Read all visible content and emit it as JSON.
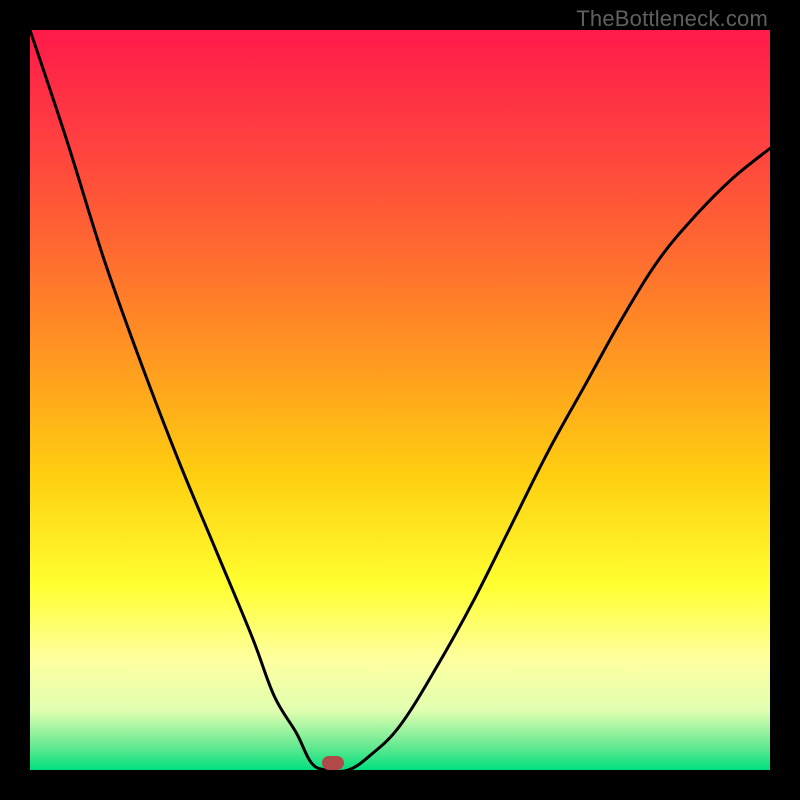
{
  "attribution": "TheBottleneck.com",
  "gradient_colors": {
    "top": "#ff1a4a",
    "mid_upper": "#ff9a20",
    "mid": "#ffff30",
    "lower": "#60e890",
    "bottom": "#00e080"
  },
  "marker": {
    "x_pct": 41.0,
    "y_pct": 99.0,
    "color": "#b04a4a"
  },
  "chart_data": {
    "type": "line",
    "title": "",
    "xlabel": "",
    "ylabel": "",
    "xlim": [
      0,
      100
    ],
    "ylim": [
      0,
      100
    ],
    "series": [
      {
        "name": "curve",
        "x": [
          0,
          5,
          10,
          15,
          20,
          25,
          30,
          33,
          36,
          38,
          40,
          43,
          46,
          50,
          55,
          60,
          65,
          70,
          75,
          80,
          85,
          90,
          95,
          100
        ],
        "values": [
          100,
          85,
          69,
          55,
          42,
          30,
          18,
          10,
          5,
          1,
          0,
          0,
          2,
          6,
          14,
          23,
          33,
          43,
          52,
          61,
          69,
          75,
          80,
          84
        ]
      }
    ],
    "marker_point": {
      "x": 41,
      "y": 0
    },
    "grid": false,
    "legend": false
  }
}
